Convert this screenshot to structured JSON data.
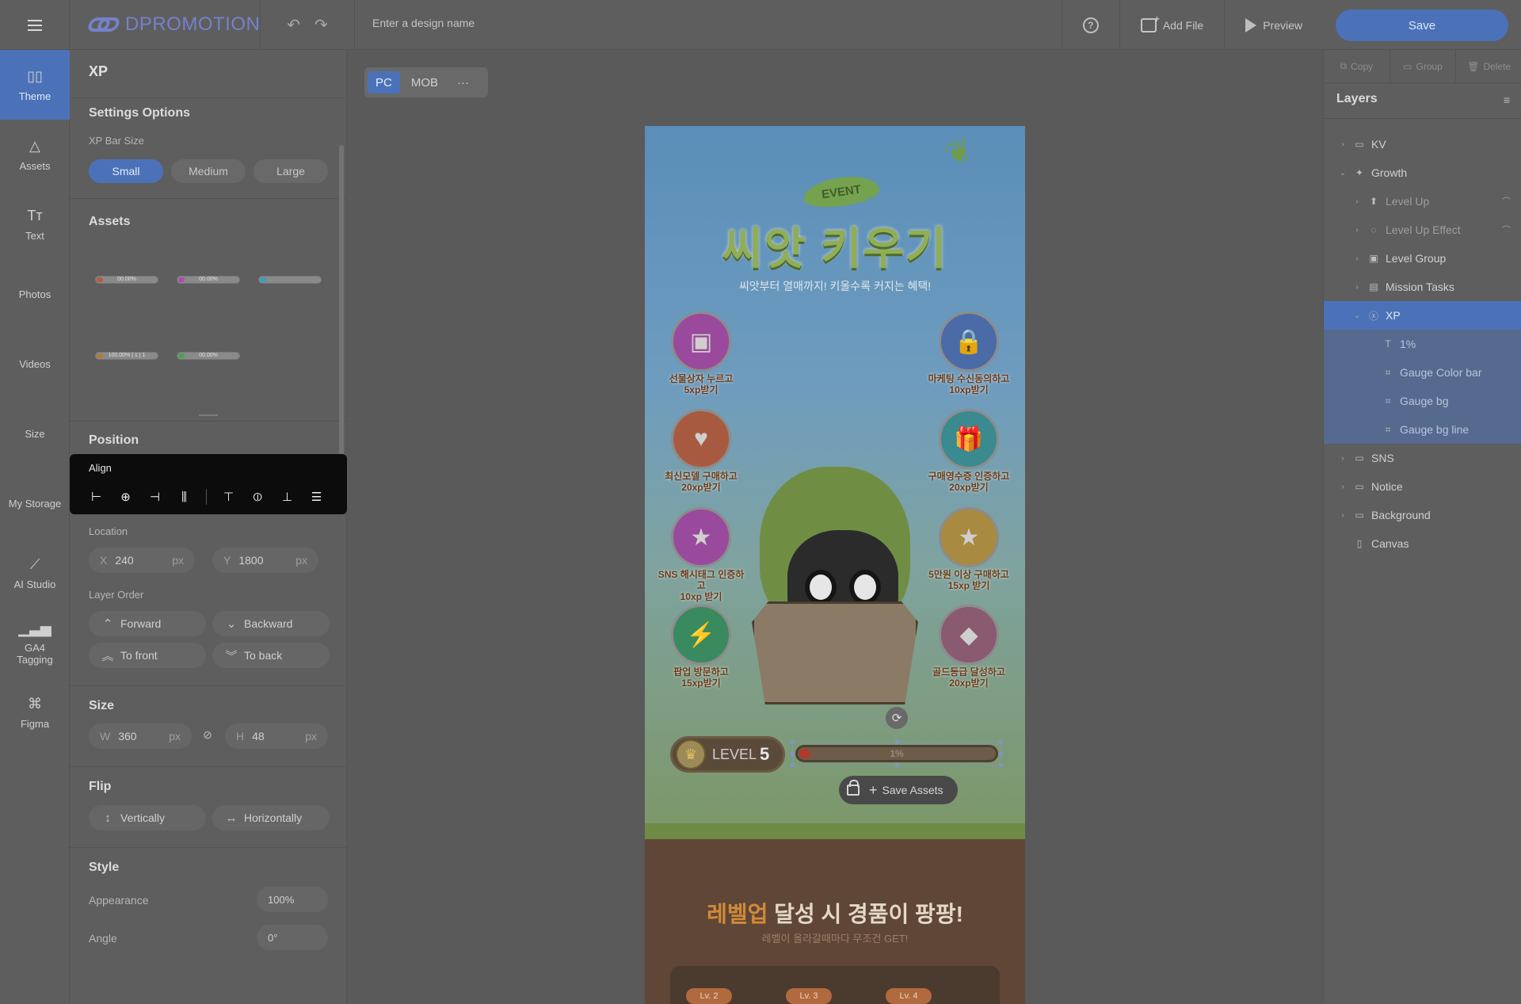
{
  "topbar": {
    "logo_text": "DPROMOTION",
    "design_name_placeholder": "Enter a design name",
    "add_file_label": "Add File",
    "preview_label": "Preview",
    "save_label": "Save"
  },
  "rail": {
    "items": [
      {
        "label": "Theme",
        "icon": "theme-icon"
      },
      {
        "label": "Assets",
        "icon": "shapes-icon"
      },
      {
        "label": "Text",
        "icon": "text-icon"
      },
      {
        "label": "Photos",
        "icon": "photo-icon"
      },
      {
        "label": "Videos",
        "icon": "video-icon"
      },
      {
        "label": "Size",
        "icon": "resize-icon"
      },
      {
        "label": "My Storage",
        "icon": "folder-icon"
      },
      {
        "label": "AI Studio",
        "icon": "magic-wand-icon"
      },
      {
        "label": "GA4 Tagging",
        "icon": "analytics-icon"
      },
      {
        "label": "Figma",
        "icon": "figma-icon"
      }
    ]
  },
  "panel": {
    "title": "XP",
    "settings_title": "Settings Options",
    "xp_bar_size_label": "XP Bar Size",
    "sizes": [
      "Small",
      "Medium",
      "Large"
    ],
    "selected_size": "Small",
    "assets_title": "Assets",
    "asset_thumbs": [
      {
        "label": "00.00%",
        "color": "#b85a3a"
      },
      {
        "label": "00.00%",
        "color": "#b04aa8"
      },
      {
        "label": "",
        "color": "#3aa0b8"
      },
      {
        "label": "100.00% | 1 | 1",
        "color": "#b07a3a"
      },
      {
        "label": "00.00%",
        "color": "#4aa050"
      }
    ],
    "position_title": "Position",
    "align_title": "Align",
    "location_label": "Location",
    "x_key": "X",
    "x_value": "240",
    "y_key": "Y",
    "y_value": "1800",
    "unit": "px",
    "layer_order_label": "Layer Order",
    "forward_label": "Forward",
    "backward_label": "Backward",
    "to_front_label": "To front",
    "to_back_label": "To back",
    "size_title": "Size",
    "w_key": "W",
    "w_value": "360",
    "h_key": "H",
    "h_value": "48",
    "flip_title": "Flip",
    "vertically_label": "Vertically",
    "horizontally_label": "Horizontally",
    "style_title": "Style",
    "appearance_label": "Appearance",
    "appearance_value": "100%",
    "angle_label": "Angle",
    "angle_value": "0°"
  },
  "canvas": {
    "tab_pc": "PC",
    "tab_mob": "MOB",
    "more": "···",
    "event_tag": "EVENT",
    "main_title": "씨앗 키우기",
    "sub_title": "씨앗부터 열매까지! 키울수록 커지는 혜택!",
    "missions": [
      {
        "line1": "선물상자 누르고",
        "line2": "5xp받기",
        "color": "#9a4a9c",
        "icon": "treasure-chest-icon",
        "glyph": "▣"
      },
      {
        "line1": "마케팅 수신동의하고",
        "line2": "10xp받기",
        "color": "#4a6aa8",
        "icon": "padlock-icon",
        "glyph": "🔒"
      },
      {
        "line1": "최신모델 구매하고",
        "line2": "20xp받기",
        "color": "#a85a40",
        "icon": "shopping-bag-icon",
        "glyph": "♥"
      },
      {
        "line1": "구매영수증 인증하고",
        "line2": "20xp받기",
        "color": "#3a8a90",
        "icon": "gift-box-icon",
        "glyph": "🎁"
      },
      {
        "line1": "SNS 해시태그 인증하고",
        "line2": "10xp 받기",
        "color": "#9a4a9c",
        "icon": "book-icon",
        "glyph": "★"
      },
      {
        "line1": "5만원 이상 구매하고",
        "line2": "15xp 받기",
        "color": "#a88a40",
        "icon": "star-coin-icon",
        "glyph": "★"
      },
      {
        "line1": "팝업 방문하고",
        "line2": "15xp받기",
        "color": "#3a8a60",
        "icon": "lightning-icon",
        "glyph": "⚡"
      },
      {
        "line1": "골드등급 달성하고",
        "line2": "20xp받기",
        "color": "#8a5a70",
        "icon": "gem-icon",
        "glyph": "◆"
      }
    ],
    "level_text": "LEVEL",
    "level_number": "5",
    "xp_percent_text": "1%",
    "xp_fraction": 0.01,
    "save_assets_label": "Save Assets",
    "reward_title_highlight": "레벨업",
    "reward_title_rest": " 달성 시 경품이 팡팡!",
    "reward_sub": "레벨이 올라갈때마다 무조건 GET!",
    "lv_chips": [
      "Lv. 2",
      "Lv. 3",
      "Lv. 4"
    ]
  },
  "right": {
    "copy_label": "Copy",
    "group_label": "Group",
    "delete_label": "Delete",
    "layers_title": "Layers",
    "layers": [
      {
        "label": "KV",
        "depth": 0,
        "chev": "›",
        "icon": "folder-icon",
        "glyph": "▭",
        "state": "normal"
      },
      {
        "label": "Growth",
        "depth": 0,
        "chev": "⌄",
        "icon": "sparkle-icon",
        "glyph": "✦",
        "state": "normal"
      },
      {
        "label": "Level Up",
        "depth": 1,
        "chev": "›",
        "icon": "up-arrow-icon",
        "glyph": "⬆",
        "state": "dim",
        "hidden": true
      },
      {
        "label": "Level Up Effect",
        "depth": 1,
        "chev": "›",
        "icon": "effect-icon",
        "glyph": "◌",
        "state": "dim",
        "hidden": true
      },
      {
        "label": "Level Group",
        "depth": 1,
        "chev": "›",
        "icon": "group-icon",
        "glyph": "▣",
        "state": "normal"
      },
      {
        "label": "Mission Tasks",
        "depth": 1,
        "chev": "›",
        "icon": "list-icon",
        "glyph": "▤",
        "state": "normal"
      },
      {
        "label": "XP",
        "depth": 1,
        "chev": "⌄",
        "icon": "xp-icon",
        "glyph": "ⓧ",
        "state": "sel"
      },
      {
        "label": "1%",
        "depth": 2,
        "chev": "",
        "icon": "text-icon",
        "glyph": "T",
        "state": "selgroup"
      },
      {
        "label": "Gauge Color bar",
        "depth": 2,
        "chev": "",
        "icon": "frame-icon",
        "glyph": "⌗",
        "state": "selgroup"
      },
      {
        "label": "Gauge bg",
        "depth": 2,
        "chev": "",
        "icon": "frame-icon",
        "glyph": "⌗",
        "state": "selgroup"
      },
      {
        "label": "Gauge bg line",
        "depth": 2,
        "chev": "",
        "icon": "frame-icon",
        "glyph": "⌗",
        "state": "selgroup"
      },
      {
        "label": "SNS",
        "depth": 0,
        "chev": "›",
        "icon": "folder-icon",
        "glyph": "▭",
        "state": "normal"
      },
      {
        "label": "Notice",
        "depth": 0,
        "chev": "›",
        "icon": "folder-icon",
        "glyph": "▭",
        "state": "normal"
      },
      {
        "label": "Background",
        "depth": 0,
        "chev": "›",
        "icon": "folder-icon",
        "glyph": "▭",
        "state": "normal"
      },
      {
        "label": "Canvas",
        "depth": 0,
        "chev": "",
        "icon": "canvas-icon",
        "glyph": "▯",
        "state": "normal"
      }
    ]
  }
}
